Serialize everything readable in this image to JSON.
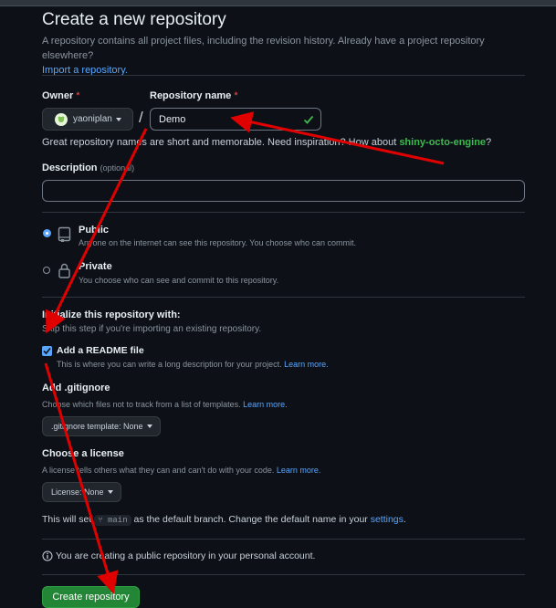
{
  "page": {
    "title": "Create a new repository",
    "subtitle": "A repository contains all project files, including the revision history. Already have a project repository elsewhere?",
    "import_link": "Import a repository."
  },
  "owner": {
    "label": "Owner",
    "required_mark": "*",
    "value": "yaoniplan",
    "avatar_icon": "user-avatar"
  },
  "separator": "/",
  "repo_name": {
    "label": "Repository name",
    "required_mark": "*",
    "value": "Demo",
    "valid_icon": "check-icon"
  },
  "suggestion": {
    "prefix": "Great repository names are short and memorable. Need inspiration? How about ",
    "name": "shiny-octo-engine",
    "suffix": "?"
  },
  "description": {
    "label": "Description",
    "optional": "(optional)",
    "value": ""
  },
  "visibility": {
    "public": {
      "label": "Public",
      "desc": "Anyone on the internet can see this repository. You choose who can commit.",
      "selected": true,
      "icon": "repo-icon"
    },
    "private": {
      "label": "Private",
      "desc": "You choose who can see and commit to this repository.",
      "selected": false,
      "icon": "lock-icon"
    }
  },
  "init": {
    "heading": "Initialize this repository with:",
    "sub": "Skip this step if you're importing an existing repository.",
    "readme": {
      "label": "Add a README file",
      "desc": "This is where you can write a long description for your project.",
      "learn": "Learn more.",
      "checked": true
    }
  },
  "gitignore": {
    "heading": "Add .gitignore",
    "desc": "Choose which files not to track from a list of templates.",
    "learn": "Learn more.",
    "button": ".gitignore template: None"
  },
  "license": {
    "heading": "Choose a license",
    "desc": "A license tells others what they can and can't do with your code.",
    "learn": "Learn more.",
    "button": "License: None"
  },
  "branch": {
    "prefix": "This will set ",
    "branch_name": "main",
    "middle": " as the default branch. Change the default name in your ",
    "settings_link": "settings",
    "suffix": "."
  },
  "info": {
    "text": "You are creating a public repository in your personal account.",
    "icon": "info-icon"
  },
  "create_button": "Create repository",
  "colors": {
    "accent": "#58a6ff",
    "success": "#238636",
    "annotation": "#e00000",
    "suggestion": "#3fb950"
  }
}
